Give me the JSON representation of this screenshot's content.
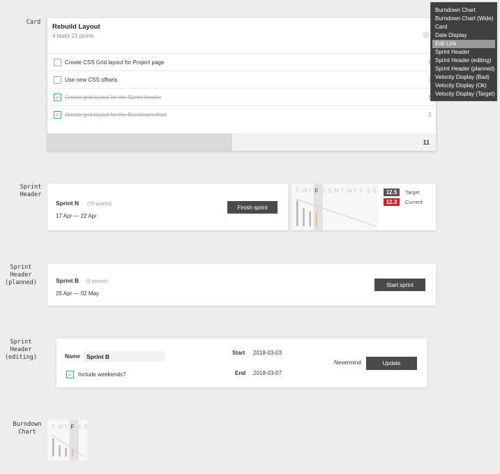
{
  "labels": {
    "card": "Card",
    "sprint_header": "Sprint\nHeader",
    "sprint_header_planned": "Sprint\nHeader\n(planned)",
    "sprint_header_editing": "Sprint\nHeader\n(editing)",
    "burndown_chart": "Burndown\nChart"
  },
  "card": {
    "title": "Rebuild Layout",
    "meta": "4 tasks 21 points",
    "tasks": [
      {
        "name": "Create CSS Grid layout for Project page",
        "points": "8",
        "done": false
      },
      {
        "name": "Use new CSS offsets",
        "points": "3",
        "done": false
      },
      {
        "name": "Create grid layout for the Sprint header",
        "points": "5",
        "done": true
      },
      {
        "name": "Create grid layout for the Burndown chart",
        "points": "5",
        "done": true
      }
    ],
    "remaining": "11",
    "progress_fraction": 0.476
  },
  "menu": {
    "items": [
      "Burndown Chart",
      "Burndown Chart (Wide)",
      "Card",
      "Date Display",
      "Edit Link",
      "Sprint Header",
      "Sprint Header (editing)",
      "Sprint Header (planned)",
      "Velocity Display (Bad)",
      "Velocity Display (Ok)",
      "Velocity Display (Target)"
    ],
    "selected": "Edit Link"
  },
  "sprint_header": {
    "name": "Sprint N",
    "points": "(75 points)",
    "dates": "17 Apr — 22 Apr",
    "button": "Finish sprint",
    "days": [
      "T",
      "W",
      "T",
      "F",
      "S",
      "S",
      "M",
      "T",
      "W",
      "T",
      "F",
      "S",
      "S"
    ],
    "today_index": 3,
    "bars": [
      0.85,
      0.6,
      0.5,
      0.45
    ],
    "target_value": "12.5",
    "target_label": "Target",
    "current_value": "12.3",
    "current_label": "Current",
    "colors": {
      "target": "#555555",
      "current": "#c0282d",
      "today_bar": "#f5c17a"
    }
  },
  "sprint_planned": {
    "name": "Sprint B",
    "points": "(0 points)",
    "dates": "25 Apr — 02 May",
    "button": "Start sprint"
  },
  "sprint_editing": {
    "name_label": "Name",
    "name_value": "Sprint B",
    "start_label": "Start",
    "start_value": "2018-03-03",
    "end_label": "End",
    "end_value": "2018-03-07",
    "weekends_label": "Include weekends?",
    "nevermind": "Nevermind",
    "update": "Update"
  },
  "burndown": {
    "days": [
      "T",
      "W",
      "T",
      "F",
      "S",
      "S"
    ],
    "today_index": 3,
    "bars": [
      0.75,
      0.45,
      0.35,
      0.3
    ]
  }
}
